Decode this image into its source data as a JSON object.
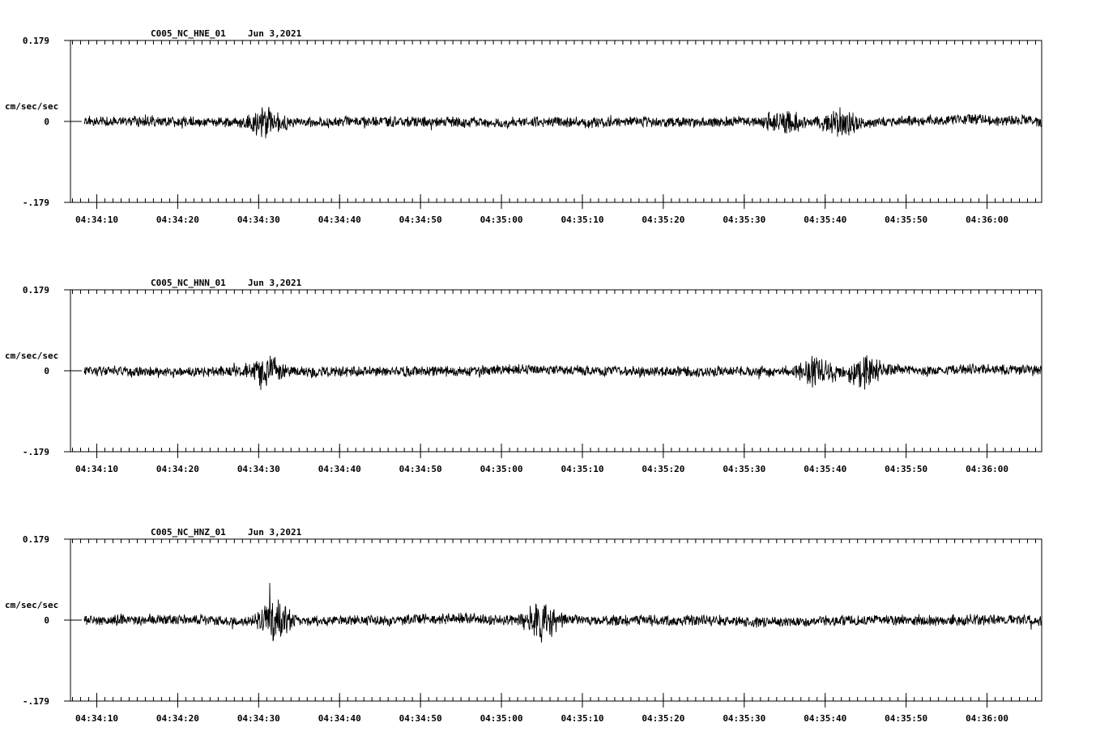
{
  "chart_data": [
    {
      "type": "line",
      "title": "C005_NC_HNE_01",
      "date": "Jun 3,2021",
      "ylabel": "cm/sec/sec",
      "ylim": [
        -0.179,
        0.179
      ],
      "yticks": [
        "0.179",
        "0",
        "-.179"
      ],
      "xlim": [
        "04:34:06.8",
        "04:36:06.8"
      ],
      "xticks": [
        "04:34:10",
        "04:34:20",
        "04:34:30",
        "04:34:40",
        "04:34:50",
        "04:35:00",
        "04:35:10",
        "04:35:20",
        "04:35:30",
        "04:35:40",
        "04:35:50",
        "04:36:00"
      ],
      "trace_start": "04:34:08.5",
      "trace_end": "04:36:06.8",
      "noise_amplitude": 0.012,
      "max_amplitude": 0.045,
      "peak_times": [
        "04:34:31",
        "04:35:35",
        "04:35:42"
      ],
      "grid": false
    },
    {
      "type": "line",
      "title": "C005_NC_HNN_01",
      "date": "Jun 3,2021",
      "ylabel": "cm/sec/sec",
      "ylim": [
        -0.179,
        0.179
      ],
      "yticks": [
        "0.179",
        "0",
        "-.179"
      ],
      "xlim": [
        "04:34:06.8",
        "04:36:06.8"
      ],
      "xticks": [
        "04:34:10",
        "04:34:20",
        "04:34:30",
        "04:34:40",
        "04:34:50",
        "04:35:00",
        "04:35:10",
        "04:35:20",
        "04:35:30",
        "04:35:40",
        "04:35:50",
        "04:36:00"
      ],
      "trace_start": "04:34:08.5",
      "trace_end": "04:36:06.8",
      "noise_amplitude": 0.012,
      "max_amplitude": 0.048,
      "peak_times": [
        "04:34:31",
        "04:35:39",
        "04:35:45"
      ],
      "grid": false
    },
    {
      "type": "line",
      "title": "C005_NC_HNZ_01",
      "date": "Jun 3,2021",
      "ylabel": "cm/sec/sec",
      "ylim": [
        -0.179,
        0.179
      ],
      "yticks": [
        "0.179",
        "0",
        "-.179"
      ],
      "xlim": [
        "04:34:06.8",
        "04:36:06.8"
      ],
      "xticks": [
        "04:34:10",
        "04:34:20",
        "04:34:30",
        "04:34:40",
        "04:34:50",
        "04:35:00",
        "04:35:10",
        "04:35:20",
        "04:35:30",
        "04:35:40",
        "04:35:50",
        "04:36:00"
      ],
      "trace_start": "04:34:08.5",
      "trace_end": "04:36:06.8",
      "noise_amplitude": 0.012,
      "max_amplitude": 0.06,
      "peak_times": [
        "04:34:32",
        "04:35:05"
      ],
      "grid": false
    }
  ]
}
